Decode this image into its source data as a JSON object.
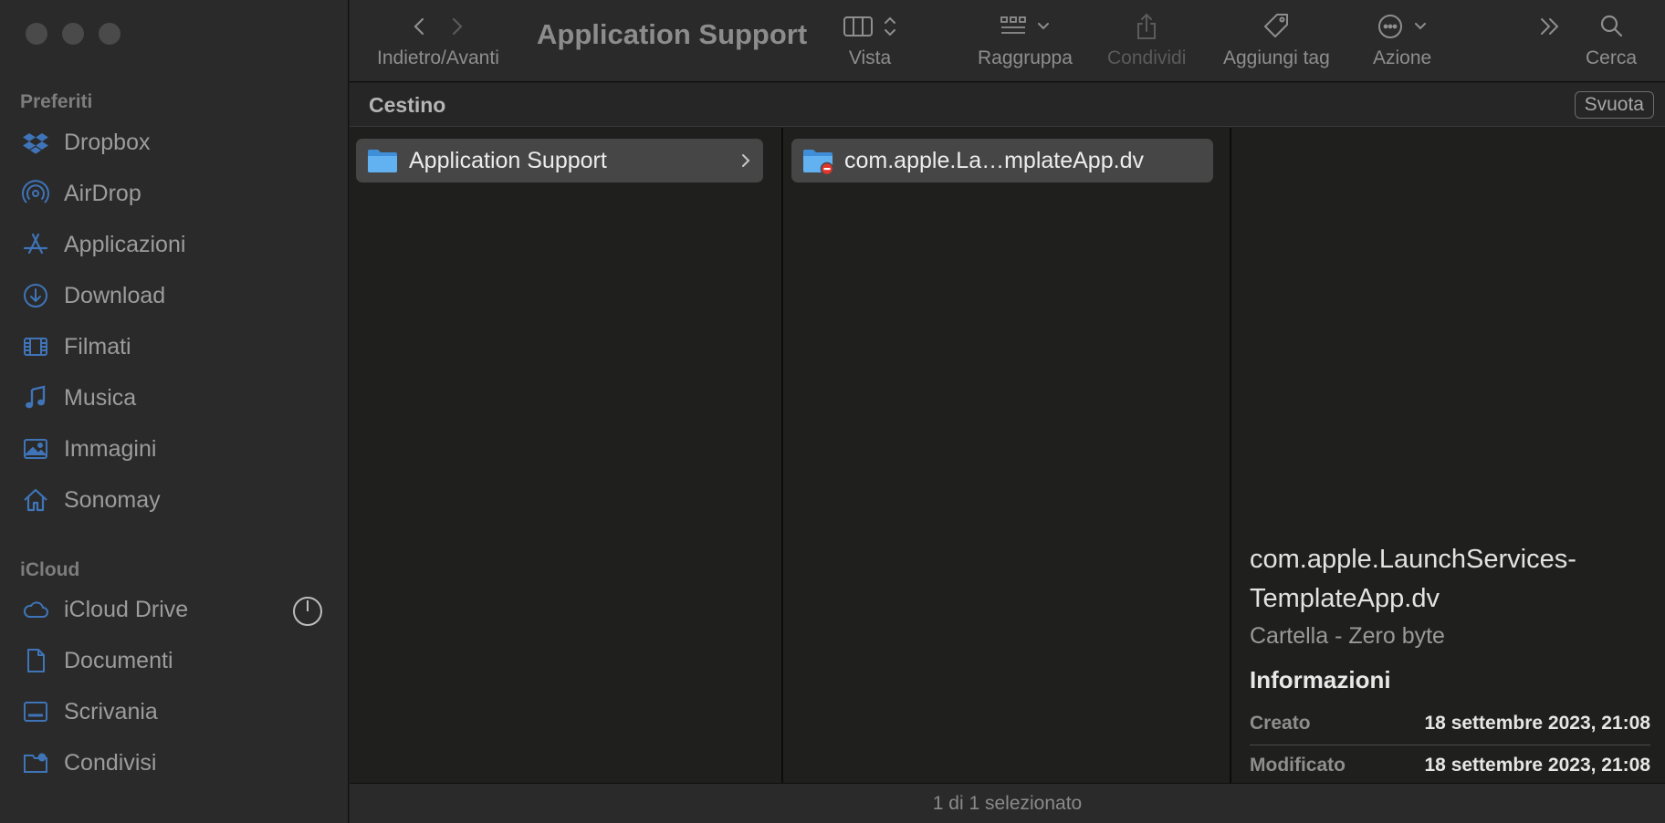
{
  "window": {
    "title": "Application Support"
  },
  "toolbar": {
    "nav_label": "Indietro/Avanti",
    "view_label": "Vista",
    "group_label": "Raggruppa",
    "share_label": "Condividi",
    "tag_label": "Aggiungi tag",
    "action_label": "Azione",
    "search_label": "Cerca"
  },
  "sidebar": {
    "favorites_title": "Preferiti",
    "favorites": [
      {
        "label": "Dropbox",
        "icon": "dropbox-icon"
      },
      {
        "label": "AirDrop",
        "icon": "airdrop-icon"
      },
      {
        "label": "Applicazioni",
        "icon": "applications-icon"
      },
      {
        "label": "Download",
        "icon": "download-icon"
      },
      {
        "label": "Filmati",
        "icon": "movies-icon"
      },
      {
        "label": "Musica",
        "icon": "music-icon"
      },
      {
        "label": "Immagini",
        "icon": "pictures-icon"
      },
      {
        "label": "Sonomay",
        "icon": "home-icon"
      }
    ],
    "icloud_title": "iCloud",
    "icloud": [
      {
        "label": "iCloud Drive",
        "icon": "cloud-icon"
      },
      {
        "label": "Documenti",
        "icon": "document-icon"
      },
      {
        "label": "Scrivania",
        "icon": "desktop-icon"
      },
      {
        "label": "Condivisi",
        "icon": "shared-folder-icon"
      }
    ]
  },
  "pathbar": {
    "title": "Cestino",
    "empty_button": "Svuota"
  },
  "columns": {
    "col1_item": "Application Support",
    "col2_item": "com.apple.La…mplateApp.dv"
  },
  "preview": {
    "name_line1": "com.apple.LaunchServices-",
    "name_line2": "TemplateApp.dv",
    "kind": "Cartella - Zero byte",
    "info_title": "Informazioni",
    "created_label": "Creato",
    "created_value": "18 settembre 2023, 21:08",
    "modified_label": "Modificato",
    "modified_value": "18 settembre 2023, 21:08"
  },
  "status": {
    "text": "1 di 1 selezionato"
  },
  "colors": {
    "accent": "#3a7bd5",
    "folder": "#5aa7e6",
    "sidebar_icon": "#3f74b8"
  }
}
